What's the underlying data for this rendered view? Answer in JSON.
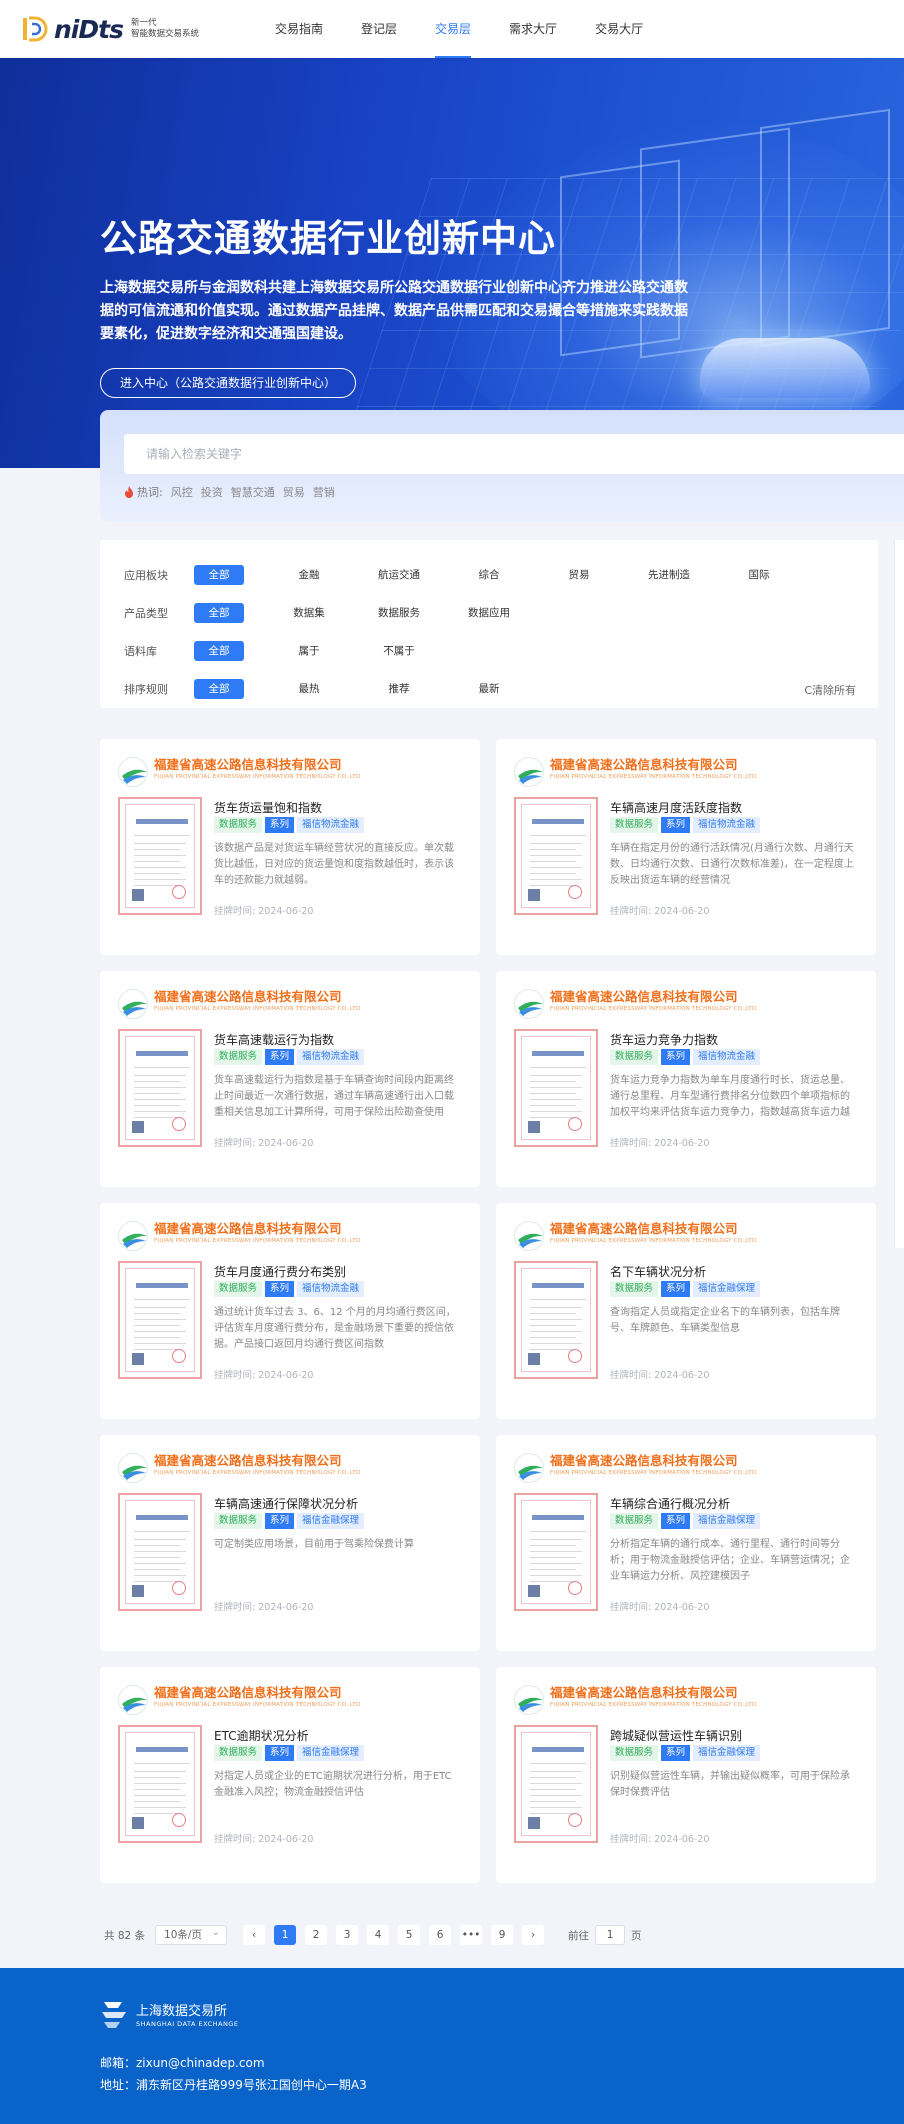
{
  "header": {
    "logo_text": "niDts",
    "logo_sub1": "新一代",
    "logo_sub2": "智能数据交易系统",
    "nav": [
      {
        "label": "交易指南",
        "active": false
      },
      {
        "label": "登记层",
        "active": false
      },
      {
        "label": "交易层",
        "active": true
      },
      {
        "label": "需求大厅",
        "active": false
      },
      {
        "label": "交易大厅",
        "active": false
      }
    ]
  },
  "hero": {
    "title": "公路交通数据行业创新中心",
    "description": "上海数据交易所与金润数科共建上海数据交易所公路交通数据行业创新中心齐力推进公路交通数据的可信流通和价值实现。通过数据产品挂牌、数据产品供需匹配和交易撮合等措施来实践数据要素化，促进数字经济和交通强国建设。",
    "button": "进入中心（公路交通数据行业创新中心）"
  },
  "search": {
    "placeholder": "请输入检索关键字",
    "hot_label": "热词:",
    "hot_words": [
      "风控",
      "投资",
      "智慧交通",
      "贸易",
      "营销"
    ]
  },
  "filters": {
    "rows": [
      {
        "label": "应用板块",
        "options": [
          "全部",
          "金融",
          "航运交通",
          "综合",
          "贸易",
          "先进制造",
          "国际"
        ],
        "active": 0
      },
      {
        "label": "产品类型",
        "options": [
          "全部",
          "数据集",
          "数据服务",
          "数据应用"
        ],
        "active": 0
      },
      {
        "label": "语料库",
        "options": [
          "全部",
          "属于",
          "不属于"
        ],
        "active": 0
      },
      {
        "label": "排序规则",
        "options": [
          "全部",
          "最热",
          "推荐",
          "最新"
        ],
        "active": 0
      }
    ],
    "clear_label": "C清除所有"
  },
  "company": {
    "name_cn": "福建省高速公路信息科技有限公司",
    "name_en": "FUJIAN PROVINCIAL EXPRESSWAY INFORMATION TECHNOLOGY CO.,LTD"
  },
  "cards": [
    {
      "title": "货车货运量饱和指数",
      "tag_type": "数据服务",
      "tag_series": "系列",
      "tag_name": "福信物流金融",
      "desc": "该数据产品是对货运车辆经营状况的直接反应。单次载货比越低，日对应的货运量饱和度指数越低时，表示该车的还款能力就越弱。",
      "time_label": "挂牌时间:",
      "time": "2024-06-20"
    },
    {
      "title": "车辆高速月度活跃度指数",
      "tag_type": "数据服务",
      "tag_series": "系列",
      "tag_name": "福信物流金融",
      "desc": "车辆在指定月份的通行活跃情况(月通行次数、月通行天数、日均通行次数、日通行次数标准差)，在一定程度上反映出货运车辆的经营情况",
      "time_label": "挂牌时间:",
      "time": "2024-06-20"
    },
    {
      "title": "货车高速载运行为指数",
      "tag_type": "数据服务",
      "tag_series": "系列",
      "tag_name": "福信物流金融",
      "desc": "货车高速载运行为指数是基于车辆查询时间段内距离终止时间最近一次通行数据，通过车辆高速通行出入口载重相关信息加工计算所得，可用于保险出险勘查使用",
      "time_label": "挂牌时间:",
      "time": "2024-06-20"
    },
    {
      "title": "货车运力竞争力指数",
      "tag_type": "数据服务",
      "tag_series": "系列",
      "tag_name": "福信物流金融",
      "desc": "货车运力竞争力指数为单车月度通行时长、货运总量、通行总里程、月车型通行费排名分位数四个单项指标的加权平均来评估货车运力竞争力，指数越高货车运力越强",
      "time_label": "挂牌时间:",
      "time": "2024-06-20"
    },
    {
      "title": "货车月度通行费分布类别",
      "tag_type": "数据服务",
      "tag_series": "系列",
      "tag_name": "福信物流金融",
      "desc": "通过统计货车过去 3、6、12 个月的月均通行费区间，评估货车月度通行费分布，是金融场景下重要的授信依据。产品接口返回月均通行费区间指数",
      "time_label": "挂牌时间:",
      "time": "2024-06-20"
    },
    {
      "title": "名下车辆状况分析",
      "tag_type": "数据服务",
      "tag_series": "系列",
      "tag_name": "福信金融保理",
      "desc": "查询指定人员或指定企业名下的车辆列表，包括车牌号、车牌颜色、车辆类型信息",
      "time_label": "挂牌时间:",
      "time": "2024-06-20"
    },
    {
      "title": "车辆高速通行保障状况分析",
      "tag_type": "数据服务",
      "tag_series": "系列",
      "tag_name": "福信金融保理",
      "desc": "可定制类应用场景，目前用于驾乘险保费计算",
      "time_label": "挂牌时间:",
      "time": "2024-06-20"
    },
    {
      "title": "车辆综合通行概况分析",
      "tag_type": "数据服务",
      "tag_series": "系列",
      "tag_name": "福信金融保理",
      "desc": "分析指定车辆的通行成本、通行里程、通行时间等分析；用于物流金融授信评估；企业、车辆营运情况；企业车辆运力分析、风控建模因子",
      "time_label": "挂牌时间:",
      "time": "2024-06-20"
    },
    {
      "title": "ETC逾期状况分析",
      "tag_type": "数据服务",
      "tag_series": "系列",
      "tag_name": "福信金融保理",
      "desc": "对指定人员或企业的ETC逾期状况进行分析，用于ETC金融准入风控；物流金融授信评估",
      "time_label": "挂牌时间:",
      "time": "2024-06-20"
    },
    {
      "title": "跨城疑似营运性车辆识别",
      "tag_type": "数据服务",
      "tag_series": "系列",
      "tag_name": "福信金融保理",
      "desc": "识别疑似营运性车辆，并输出疑似概率，可用于保险承保时保费评估",
      "time_label": "挂牌时间:",
      "time": "2024-06-20"
    }
  ],
  "pagination": {
    "total": "共 82 条",
    "page_size": "10条/页",
    "prev": "‹",
    "next": "›",
    "pages": [
      "1",
      "2",
      "3",
      "4",
      "5",
      "6",
      "•••",
      "9"
    ],
    "current": "1",
    "goto_label": "前往",
    "goto_value": "1",
    "unit": "页"
  },
  "footer": {
    "name_cn": "上海数据交易所",
    "name_en": "SHANGHAI DATA EXCHANGE",
    "email": "邮箱：zixun@chinadep.com",
    "address": "地址：浦东新区丹桂路999号张江国创中心一期A3"
  },
  "colors": {
    "accent": "#2f7bf5",
    "company": "#f06f1a",
    "footer": "#0a63c9",
    "hero": "#1740c0"
  }
}
